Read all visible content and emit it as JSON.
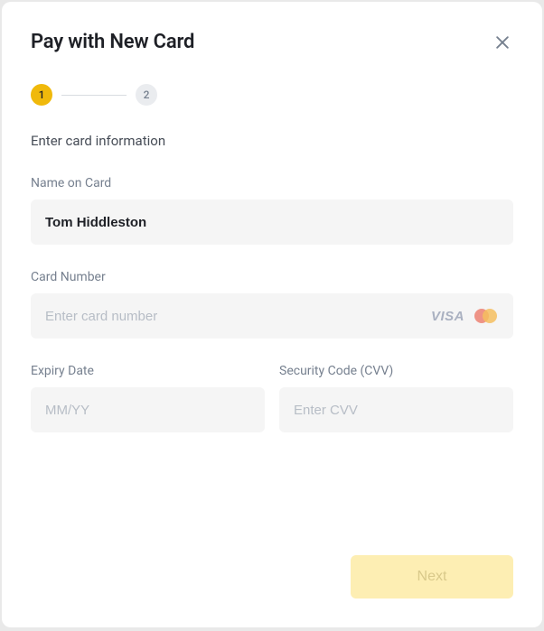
{
  "title": "Pay with New Card",
  "steps": {
    "one": "1",
    "two": "2"
  },
  "instruction": "Enter card information",
  "fields": {
    "name": {
      "label": "Name on Card",
      "value": "Tom Hiddleston"
    },
    "card_number": {
      "label": "Card Number",
      "placeholder": "Enter card number"
    },
    "expiry": {
      "label": "Expiry Date",
      "placeholder": "MM/YY"
    },
    "cvv": {
      "label": "Security Code (CVV)",
      "placeholder": "Enter CVV"
    }
  },
  "brands": {
    "visa": "VISA"
  },
  "next_label": "Next"
}
